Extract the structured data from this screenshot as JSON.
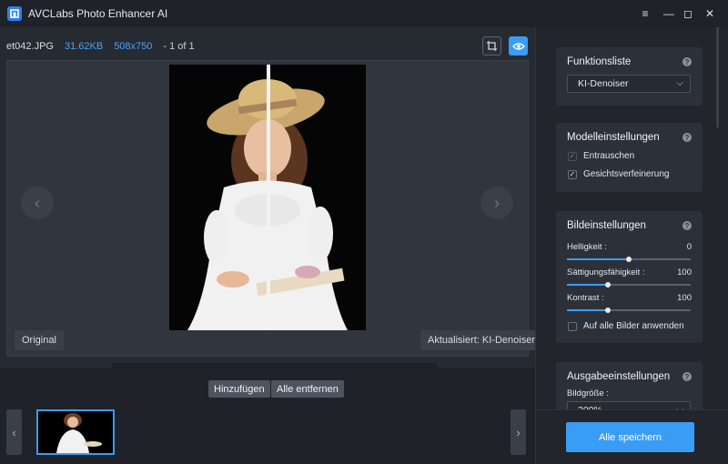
{
  "app": {
    "title": "AVCLabs Photo Enhancer AI",
    "window_controls": [
      "≡",
      "—",
      "◻",
      "✕"
    ]
  },
  "file_info": {
    "name": "et042.JPG",
    "size": "31.62KB",
    "dimensions": "508x750",
    "page": "- 1 of 1"
  },
  "preview": {
    "label_original": "Original",
    "label_updated": "Aktualisiert: KI-Denoiser"
  },
  "toolbar": {
    "icons": [
      "split-view-icon",
      "compare-view-icon",
      "fit-screen-icon",
      "zoom-in-icon",
      "zoom-out-icon",
      "crop-icon",
      "save-icon",
      "delete-icon",
      "undo-arrow-icon",
      "redo-arrow-icon",
      "rotate-icon"
    ]
  },
  "strip": {
    "add_label": "Hinzufügen",
    "remove_all_label": "Alle entfernen"
  },
  "panels": {
    "functions": {
      "title": "Funktionsliste",
      "selected": "KI-Denoiser"
    },
    "model": {
      "title": "Modelleinstellungen",
      "options": [
        {
          "label": "Entrauschen",
          "checked": true,
          "disabled": true
        },
        {
          "label": "Gesichtsverfeinerung",
          "checked": true,
          "disabled": false
        }
      ]
    },
    "image": {
      "title": "Bildeinstellungen",
      "sliders": [
        {
          "label": "Helligkeit :",
          "value": "0",
          "position": 0.5
        },
        {
          "label": "Sättigungsfähigkeit :",
          "value": "100",
          "position": 0.33
        },
        {
          "label": "Kontrast :",
          "value": "100",
          "position": 0.33
        }
      ],
      "apply_all": "Auf alle Bilder anwenden"
    },
    "output": {
      "title": "Ausgabeeinstellungen",
      "size_label": "Bildgröße :",
      "size_value": "200%"
    }
  },
  "save_all": "Alle speichern",
  "colors": {
    "accent": "#3a9df5",
    "bg": "#1f2228",
    "panel": "#2c3038"
  }
}
